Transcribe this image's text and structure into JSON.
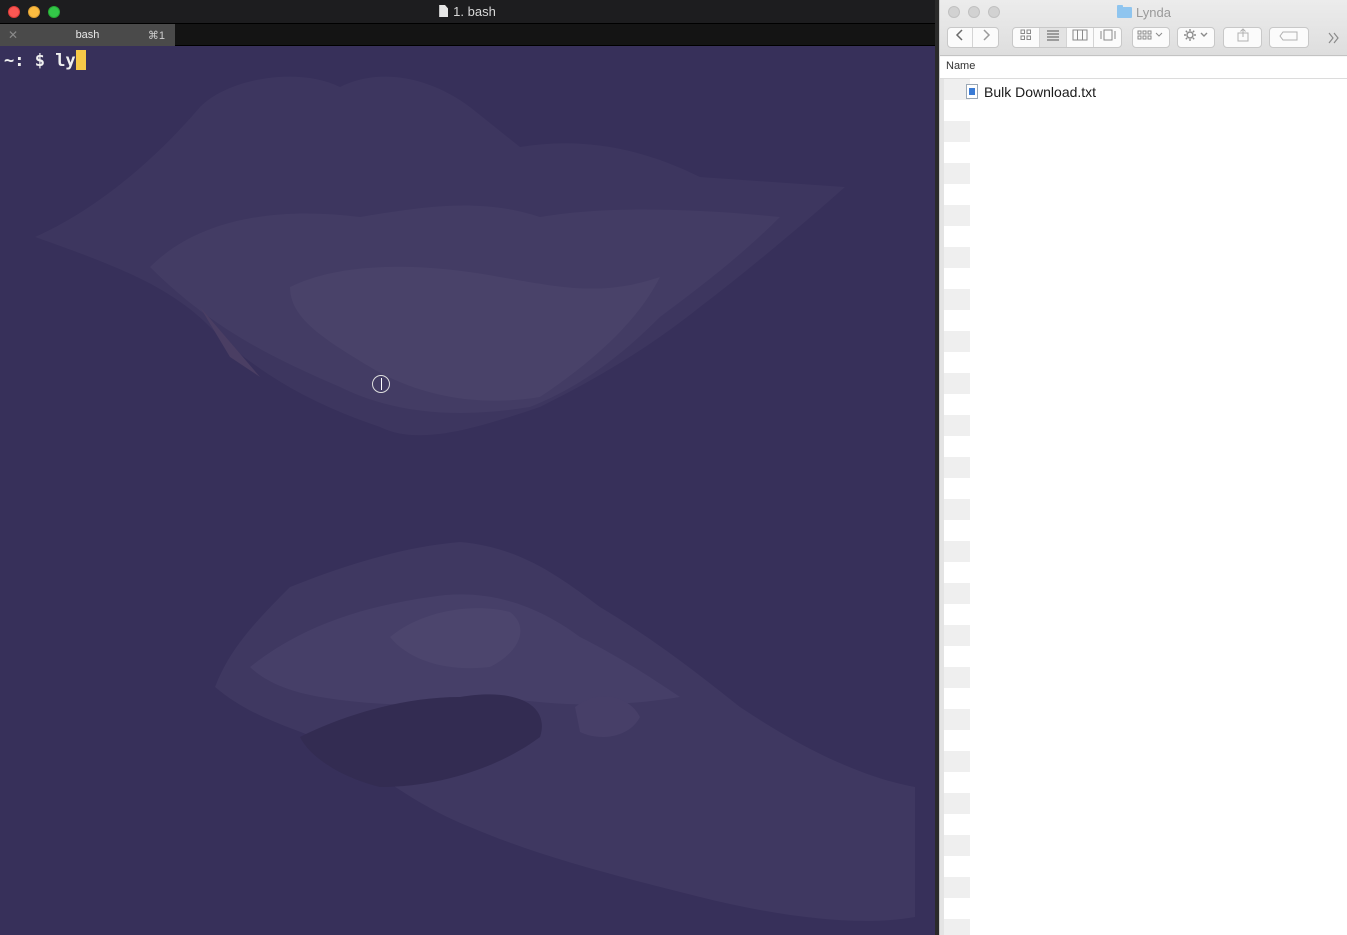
{
  "terminal": {
    "window_title": "1. bash",
    "tab": {
      "label": "bash",
      "shortcut": "⌘1",
      "close_glyph": "✕"
    },
    "prompt": "~: $ ",
    "typed_text": "ly",
    "cursor_color": "#f7c948",
    "background_color": "#37305a"
  },
  "finder": {
    "window_title": "Lynda",
    "toolbar": {
      "back_icon": "chevron-left-icon",
      "forward_icon": "chevron-right-icon",
      "view_icons": [
        "icon-view-icon",
        "list-view-icon",
        "column-view-icon",
        "cover-flow-icon"
      ],
      "group_icon": "group-by-icon",
      "action_icon": "gear-icon",
      "share_icon": "share-icon",
      "tag_icon": "tag-icon",
      "overflow_icon": "chevron-double-right-icon"
    },
    "list": {
      "column_header": "Name",
      "files": [
        {
          "name": "Bulk Download.txt",
          "icon": "text-file-icon"
        }
      ]
    }
  }
}
